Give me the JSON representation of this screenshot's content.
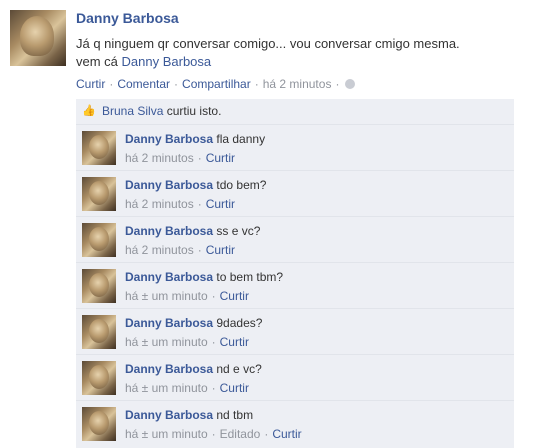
{
  "post": {
    "author": "Danny Barbosa",
    "text_main": "Já q ninguem qr conversar comigo... vou conversar cmigo mesma.",
    "text_prefix": "vem cá",
    "text_mention": "Danny Barbosa",
    "actions": {
      "like": "Curtir",
      "comment": "Comentar",
      "share": "Compartilhar",
      "time": "há 2 minutos"
    }
  },
  "likes": {
    "name": "Bruna Silva",
    "text": "curtiu isto."
  },
  "comments": [
    {
      "author": "Danny Barbosa",
      "text": "fla danny",
      "time": "há 2 minutos",
      "like": "Curtir"
    },
    {
      "author": "Danny Barbosa",
      "text": "tdo bem?",
      "time": "há 2 minutos",
      "like": "Curtir"
    },
    {
      "author": "Danny Barbosa",
      "text": "ss e vc?",
      "time": "há 2 minutos",
      "like": "Curtir"
    },
    {
      "author": "Danny Barbosa",
      "text": "to bem tbm?",
      "time": "há ± um minuto",
      "like": "Curtir"
    },
    {
      "author": "Danny Barbosa",
      "text": "9dades?",
      "time": "há ± um minuto",
      "like": "Curtir"
    },
    {
      "author": "Danny Barbosa",
      "text": "nd e vc?",
      "time": "há ± um minuto",
      "like": "Curtir"
    },
    {
      "author": "Danny Barbosa",
      "text": "nd tbm",
      "time": "há ± um minuto",
      "edited": "Editado",
      "like": "Curtir"
    }
  ],
  "colors": {
    "link": "#3b5998",
    "muted": "#90949c",
    "feedback_bg": "#edeff4"
  },
  "icons": {
    "like": "thumbs-up-icon",
    "audience": "globe-icon"
  }
}
